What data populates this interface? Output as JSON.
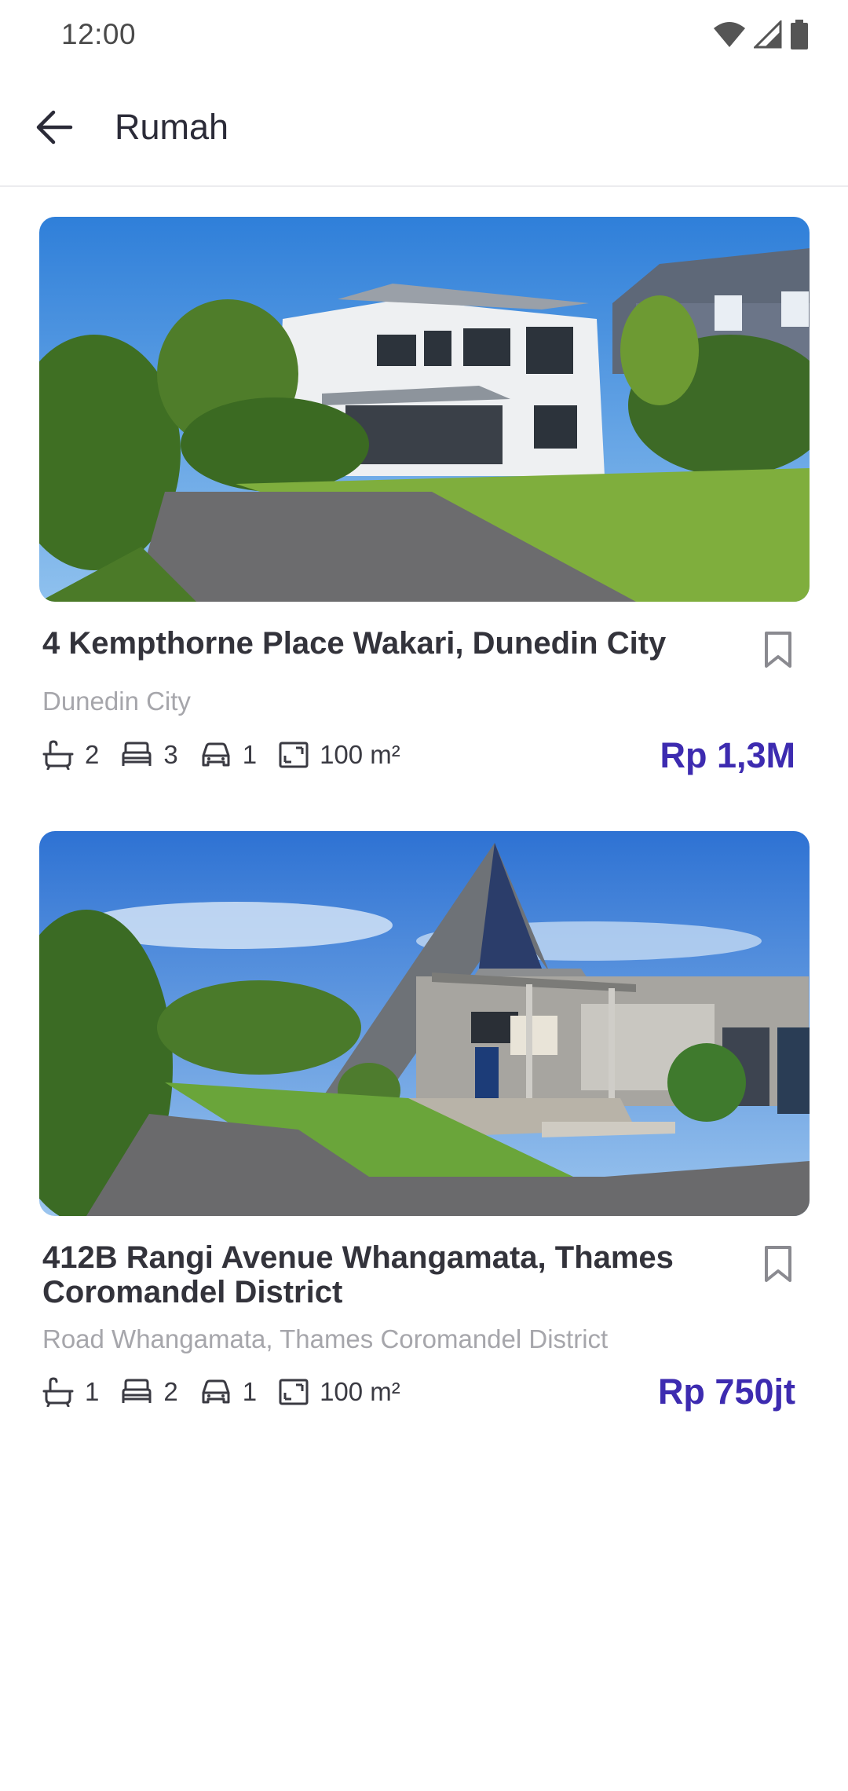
{
  "status_bar": {
    "time": "12:00",
    "icons": [
      "wifi-icon",
      "signal-icon",
      "battery-icon"
    ]
  },
  "app_bar": {
    "title": "Rumah",
    "back_icon": "arrow-left-icon"
  },
  "listings": [
    {
      "image": "house-photo-two-storey-white",
      "title": "4 Kempthorne Place Wakari, Dunedin City",
      "subtitle": "Dunedin City",
      "bath": "2",
      "bed": "3",
      "car": "1",
      "area": "100 m²",
      "price": "Rp 1,3M",
      "bookmark_icon": "bookmark-icon"
    },
    {
      "image": "house-photo-a-frame",
      "title": "412B Rangi Avenue Whangamata, Thames Coromandel District",
      "subtitle": "Road Whangamata, Thames Coromandel District",
      "bath": "1",
      "bed": "2",
      "car": "1",
      "area": "100 m²",
      "price": "Rp 750jt",
      "bookmark_icon": "bookmark-icon"
    }
  ],
  "colors": {
    "accent": "#3d2bb0",
    "text": "#33333b",
    "muted": "#a6a6ab"
  }
}
